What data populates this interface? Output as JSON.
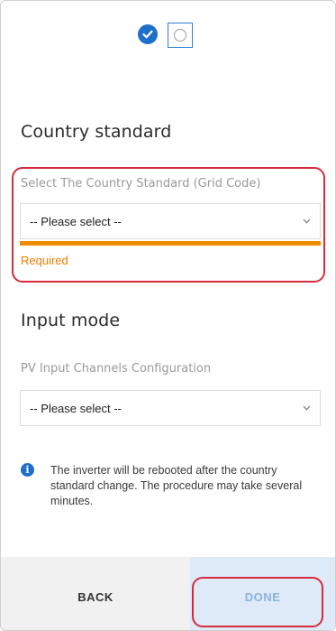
{
  "stepper": {
    "completed_step_icon": "check-icon",
    "current_step_icon": "radio-empty-icon"
  },
  "country_standard": {
    "title": "Country standard",
    "field_label": "Select The Country Standard (Grid Code)",
    "selected_value": "-- Please select --",
    "error_text": "Required"
  },
  "input_mode": {
    "title": "Input mode",
    "field_label": "PV Input Channels Configuration",
    "selected_value": "-- Please select --"
  },
  "info": {
    "icon": "info-icon",
    "text": "The inverter will be rebooted after the country standard change. The procedure may take several minutes."
  },
  "footer": {
    "back_label": "BACK",
    "done_label": "DONE"
  },
  "colors": {
    "accent_blue": "#1d6fc9",
    "error_orange": "#f28c00",
    "highlight_red": "#d62b3c"
  }
}
